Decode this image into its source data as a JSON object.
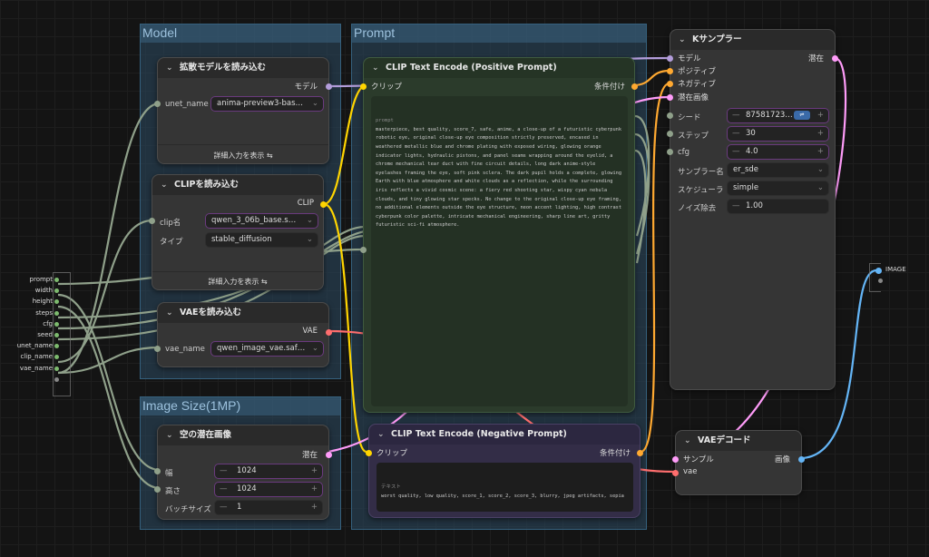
{
  "groups": {
    "model": "Model",
    "prompt": "Prompt",
    "image_size": "Image Size(1MP)"
  },
  "unet_node": {
    "title": "拡散モデルを読み込む",
    "output": "モデル",
    "widget_label": "unet_name",
    "widget_value": "anima-preview3-bas…",
    "advanced": "詳細入力を表示"
  },
  "clip_node": {
    "title": "CLIPを読み込む",
    "output": "CLIP",
    "clip_label": "clip名",
    "clip_value": "qwen_3_06b_base.s…",
    "type_label": "タイプ",
    "type_value": "stable_diffusion",
    "advanced": "詳細入力を表示"
  },
  "vae_loader": {
    "title": "VAEを読み込む",
    "output": "VAE",
    "widget_label": "vae_name",
    "widget_value": "qwen_image_vae.saf…"
  },
  "latent_node": {
    "title": "空の潜在画像",
    "output": "潜在",
    "width_label": "幅",
    "width_value": "1024",
    "height_label": "高さ",
    "height_value": "1024",
    "batch_label": "バッチサイズ",
    "batch_value": "1"
  },
  "pos_prompt": {
    "title": "CLIP Text Encode (Positive Prompt)",
    "input": "クリップ",
    "output": "条件付け",
    "field_label": "prompt",
    "text": "masterpiece, best quality, score_7, safe, anime, a close-up of a futuristic cyberpunk robotic eye, original close-up eye composition strictly preserved, encased in weathered metallic blue and chrome plating with exposed wiring, glowing orange indicator lights, hydraulic pistons, and panel seams wrapping around the eyelid, a chrome mechanical tear duct with fine circuit details, long dark anime-style eyelashes framing the eye, soft pink sclera. The dark pupil holds a complete, glowing Earth with blue atmosphere and white clouds as a reflection, while the surrounding iris reflects a vivid cosmic scene: a fiery red shooting star, wispy cyan nebula clouds, and tiny glowing star specks. No change to the original close-up eye framing, no additional elements outside the eye structure, neon accent lighting, high contrast cyberpunk color palette, intricate mechanical engineering, sharp line art, gritty futuristic sci-fi atmosphere."
  },
  "neg_prompt": {
    "title": "CLIP Text Encode (Negative Prompt)",
    "input": "クリップ",
    "output": "条件付け",
    "field_label": "テキスト",
    "text": "worst quality, low quality, score_1, score_2, score_3, blurry, jpeg artifacts, sepia"
  },
  "ksampler": {
    "title": "Kサンプラー",
    "inputs": [
      "モデル",
      "ポジティブ",
      "ネガティブ",
      "潜在画像"
    ],
    "output": "潜在",
    "seed_label": "シード",
    "seed_value": "87581723…",
    "steps_label": "ステップ",
    "steps_value": "30",
    "cfg_label": "cfg",
    "cfg_value": "4.0",
    "sampler_label": "サンプラー名",
    "sampler_value": "er_sde",
    "scheduler_label": "スケジューラ",
    "scheduler_value": "simple",
    "denoise_label": "ノイズ除去",
    "denoise_value": "1.00"
  },
  "vae_decode": {
    "title": "VAEデコード",
    "input_samples": "サンプル",
    "input_vae": "vae",
    "output": "画像"
  },
  "left_inputs": [
    "prompt",
    "width",
    "height",
    "steps",
    "cfg",
    "seed",
    "unet_name",
    "clip_name",
    "vae_name"
  ],
  "right_output": "IMAGE",
  "colors": {
    "model": "#b39ddb",
    "clip": "#ffd500",
    "conditioning": "#ffa931",
    "latent": "#ff9cf9",
    "vae": "#ff6e6e",
    "image": "#64b5f6",
    "widget": "#7dba6e"
  }
}
